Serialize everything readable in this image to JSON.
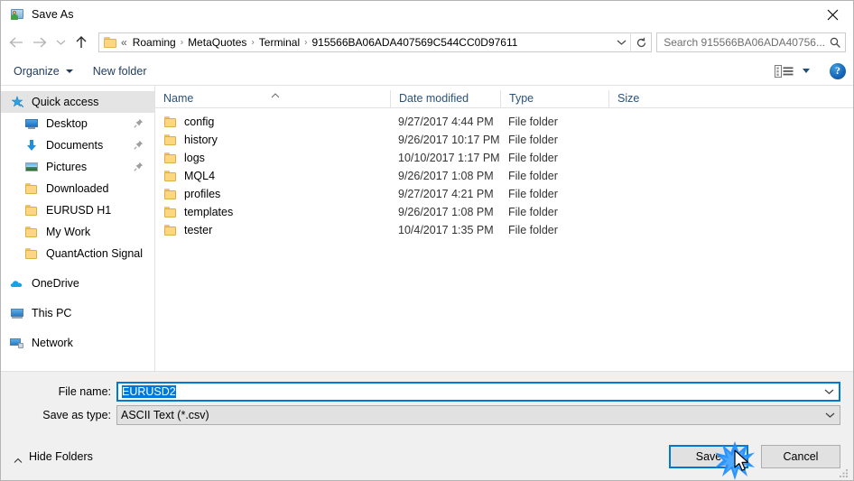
{
  "window": {
    "title": "Save As",
    "title_icon": "save-as-folder-person-icon",
    "close_label": "✕"
  },
  "navbar": {
    "back_icon": "arrow-left-icon",
    "forward_icon": "arrow-right-icon",
    "recent_icon": "chevron-down-icon",
    "up_icon": "arrow-up-icon",
    "address": {
      "folder_icon": "folder-icon",
      "overflow": "«",
      "crumbs": [
        "Roaming",
        "MetaQuotes",
        "Terminal",
        "915566BA06ADA407569C544CC0D97611"
      ],
      "separator": "›",
      "dropdown_icon": "chevron-down-icon",
      "refresh_icon": "refresh-icon"
    },
    "search": {
      "placeholder": "Search 915566BA06ADA40756...",
      "icon": "search-icon"
    }
  },
  "commandbar": {
    "organize": "Organize",
    "new_folder": "New folder",
    "view_icon": "view-layout-icon",
    "view_caret_icon": "chevron-down-icon",
    "help": "?"
  },
  "sidebar": {
    "items": [
      {
        "label": "Quick access",
        "icon": "star-pin-icon",
        "selected": true,
        "indent": 0,
        "pinned": false,
        "group": false
      },
      {
        "label": "Desktop",
        "icon": "monitor-icon",
        "selected": false,
        "indent": 1,
        "pinned": true,
        "group": false
      },
      {
        "label": "Documents",
        "icon": "documents-arrow-icon",
        "selected": false,
        "indent": 1,
        "pinned": true,
        "group": false
      },
      {
        "label": "Pictures",
        "icon": "pictures-icon",
        "selected": false,
        "indent": 1,
        "pinned": true,
        "group": false
      },
      {
        "label": "Downloaded",
        "icon": "folder-icon",
        "selected": false,
        "indent": 1,
        "pinned": false,
        "group": false
      },
      {
        "label": "EURUSD H1",
        "icon": "folder-icon",
        "selected": false,
        "indent": 1,
        "pinned": false,
        "group": false
      },
      {
        "label": "My Work",
        "icon": "folder-icon",
        "selected": false,
        "indent": 1,
        "pinned": false,
        "group": false
      },
      {
        "label": "QuantAction Signal",
        "icon": "folder-icon",
        "selected": false,
        "indent": 1,
        "pinned": false,
        "group": false
      },
      {
        "label": "OneDrive",
        "icon": "onedrive-cloud-icon",
        "selected": false,
        "indent": 0,
        "pinned": false,
        "group": true
      },
      {
        "label": "This PC",
        "icon": "this-pc-icon",
        "selected": false,
        "indent": 0,
        "pinned": false,
        "group": true
      },
      {
        "label": "Network",
        "icon": "network-icon",
        "selected": false,
        "indent": 0,
        "pinned": false,
        "group": true
      }
    ]
  },
  "filelist": {
    "columns": [
      "Name",
      "Date modified",
      "Type",
      "Size"
    ],
    "sort_column": "Name",
    "sort_direction": "ascending",
    "rows": [
      {
        "name": "config",
        "date": "9/27/2017 4:44 PM",
        "type": "File folder",
        "size": ""
      },
      {
        "name": "history",
        "date": "9/26/2017 10:17 PM",
        "type": "File folder",
        "size": ""
      },
      {
        "name": "logs",
        "date": "10/10/2017 1:17 PM",
        "type": "File folder",
        "size": ""
      },
      {
        "name": "MQL4",
        "date": "9/26/2017 1:08 PM",
        "type": "File folder",
        "size": ""
      },
      {
        "name": "profiles",
        "date": "9/27/2017 4:21 PM",
        "type": "File folder",
        "size": ""
      },
      {
        "name": "templates",
        "date": "9/26/2017 1:08 PM",
        "type": "File folder",
        "size": ""
      },
      {
        "name": "tester",
        "date": "10/4/2017 1:35 PM",
        "type": "File folder",
        "size": ""
      }
    ]
  },
  "form": {
    "filename_label": "File name:",
    "filename_value": "EURUSD2",
    "filename_selected": true,
    "filetype_label": "Save as type:",
    "filetype_value": "ASCII Text (*.csv)",
    "dropdown_icon": "chevron-down-icon"
  },
  "footer": {
    "hide_folders": "Hide Folders",
    "hide_folders_icon": "chevron-up-icon",
    "save_label": "Save",
    "cancel_label": "Cancel",
    "resize_grip_icon": "resize-grip-icon"
  },
  "overlay": {
    "click_effect_icon": "click-burst-icon",
    "cursor_icon": "mouse-pointer-icon",
    "accent_color": "#0078d7",
    "burst_color": "#1a8cff"
  }
}
